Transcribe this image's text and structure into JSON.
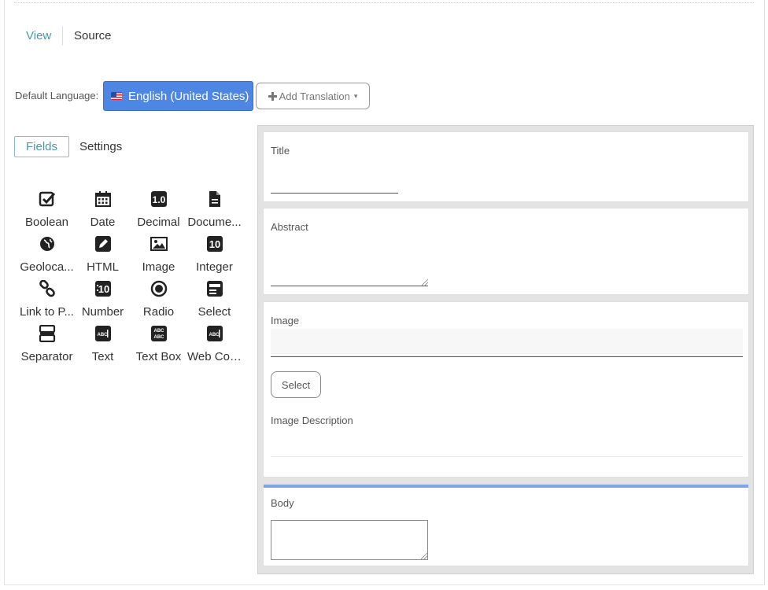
{
  "tabs": {
    "view": "View",
    "source": "Source"
  },
  "language": {
    "label": "Default Language:",
    "current": "English (United States)",
    "add_translation": "Add Translation"
  },
  "panel_tabs": {
    "fields": "Fields",
    "settings": "Settings"
  },
  "palette": [
    {
      "label": "Boolean",
      "icon": "checkbox-icon"
    },
    {
      "label": "Date",
      "icon": "calendar-icon"
    },
    {
      "label": "Decimal",
      "icon": "decimal-icon"
    },
    {
      "label": "Docume...",
      "icon": "document-icon"
    },
    {
      "label": "Geoloca...",
      "icon": "globe-icon"
    },
    {
      "label": "HTML",
      "icon": "pencil-icon"
    },
    {
      "label": "Image",
      "icon": "image-icon"
    },
    {
      "label": "Integer",
      "icon": "integer-icon"
    },
    {
      "label": "Link to P...",
      "icon": "link-icon"
    },
    {
      "label": "Number",
      "icon": "number-icon"
    },
    {
      "label": "Radio",
      "icon": "radio-icon"
    },
    {
      "label": "Select",
      "icon": "select-icon"
    },
    {
      "label": "Separator",
      "icon": "separator-icon"
    },
    {
      "label": "Text",
      "icon": "text-icon"
    },
    {
      "label": "Text Box",
      "icon": "text-box-icon"
    },
    {
      "label": "Web Con...",
      "icon": "web-content-icon"
    }
  ],
  "form": {
    "title_label": "Title",
    "abstract_label": "Abstract",
    "image_label": "Image",
    "select_button": "Select",
    "image_description_label": "Image Description",
    "body_label": "Body"
  },
  "colors": {
    "accent_blue": "#4e86e4",
    "link_teal": "#4d97a5",
    "active_border": "#7ea5e8"
  }
}
